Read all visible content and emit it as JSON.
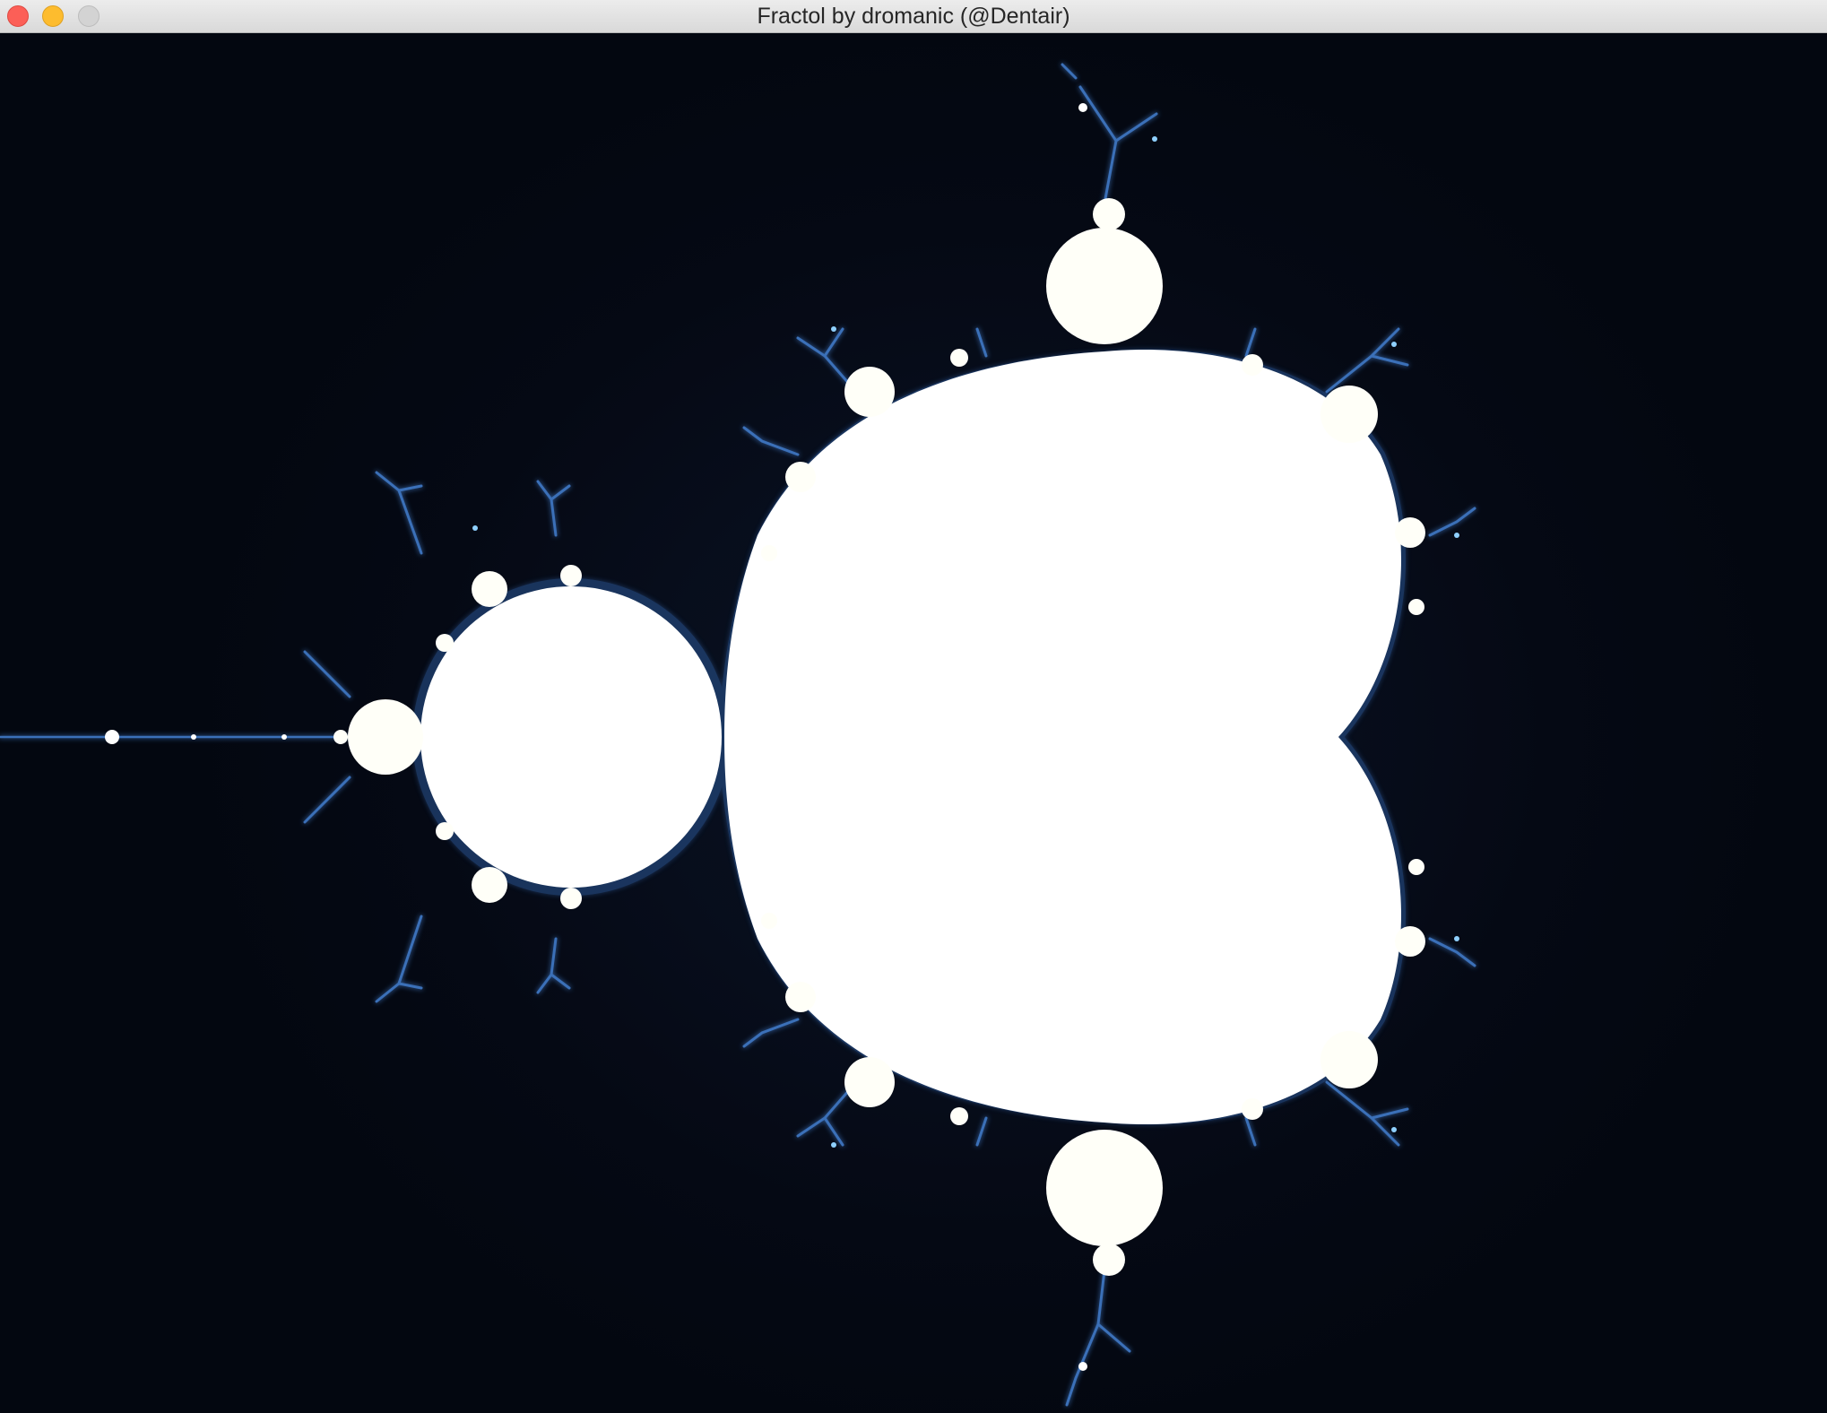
{
  "window": {
    "title": "Fractol by dromanic (@Dentair)"
  },
  "controls": {
    "close_icon": "close-icon",
    "minimize_icon": "minimize-icon",
    "zoom_icon": "zoom-icon"
  },
  "colors": {
    "background": "#050914",
    "set_interior": "#ffffff",
    "edge_glow": "#3a6fb8",
    "edge_bright": "#8fd0ff"
  },
  "fractal": {
    "type": "mandelbrot"
  }
}
